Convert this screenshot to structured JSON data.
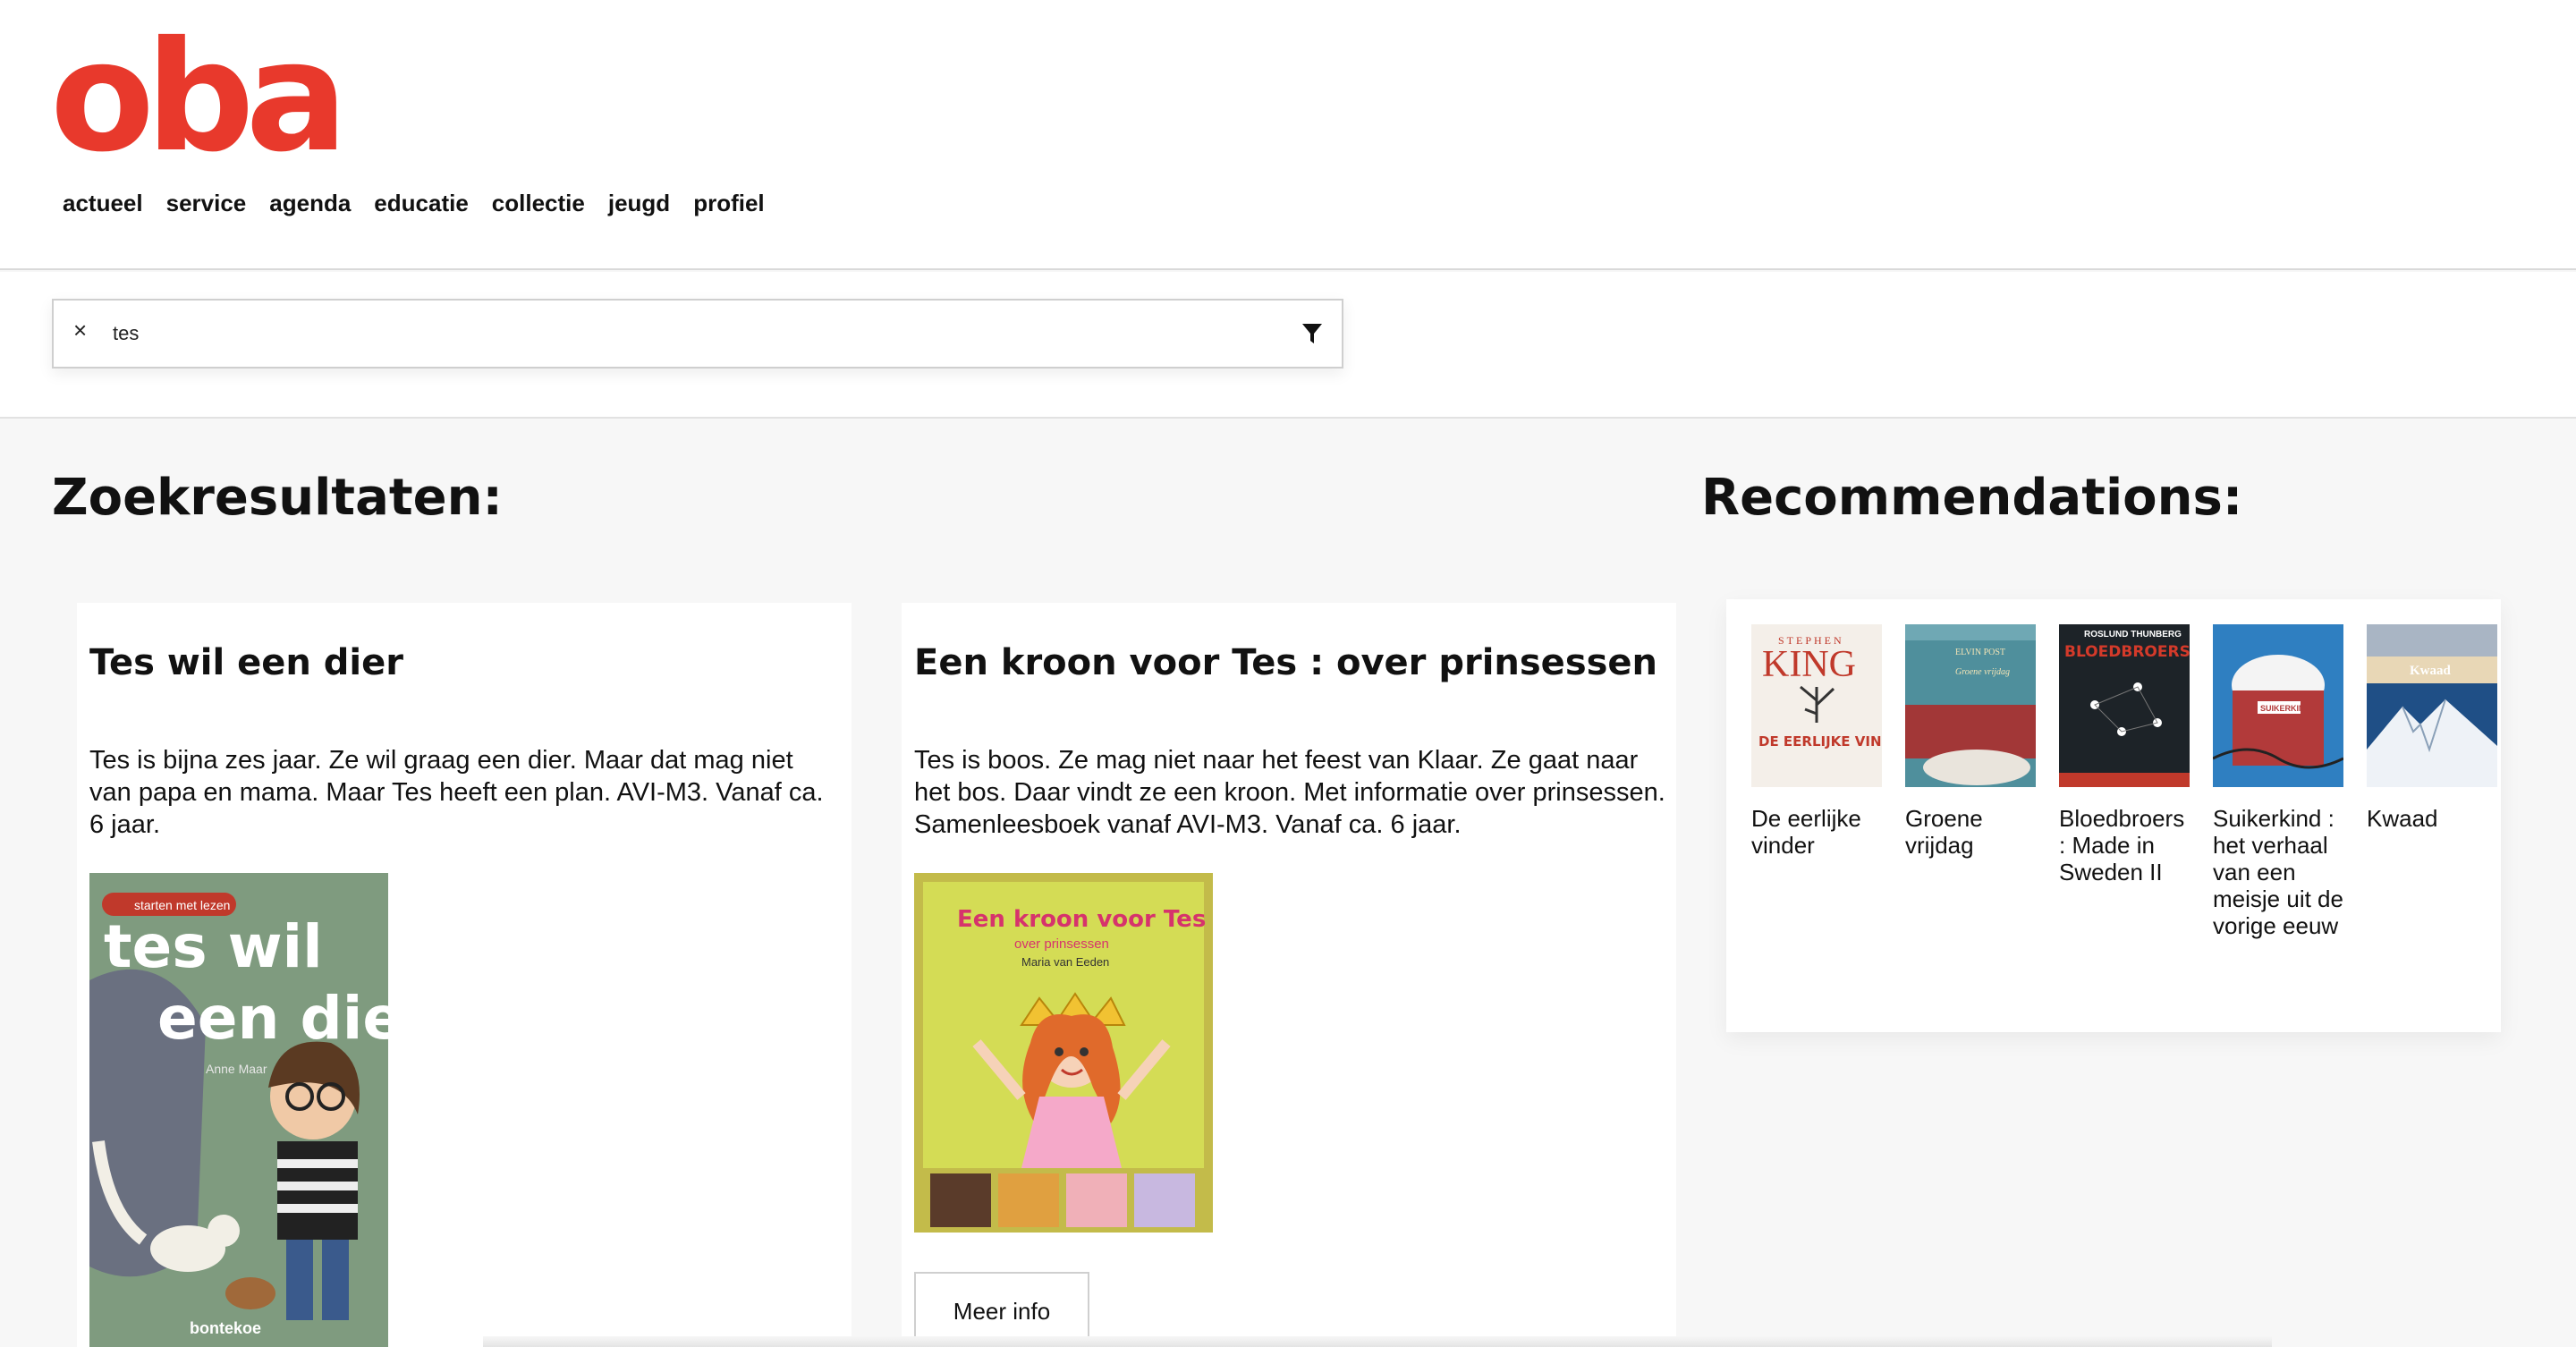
{
  "brand": {
    "logo_text": "oba",
    "color": "#e8392c"
  },
  "nav": {
    "items": [
      {
        "label": "actueel"
      },
      {
        "label": "service"
      },
      {
        "label": "agenda"
      },
      {
        "label": "educatie"
      },
      {
        "label": "collectie"
      },
      {
        "label": "jeugd"
      },
      {
        "label": "profiel"
      }
    ]
  },
  "search": {
    "clear_label": "×",
    "value": "tes"
  },
  "results": {
    "heading": "Zoekresultaten:",
    "items": [
      {
        "title": "Tes wil een dier",
        "description": "Tes is bijna zes jaar. Ze wil graag een dier. Maar dat mag niet van papa en mama. Maar Tes heeft een plan. AVI-M3. Vanaf ca. 6 jaar.",
        "cover": {
          "series": "starten met lezen",
          "line1": "tes wil",
          "line2": "een dier",
          "author": "Anne Maar",
          "publisher": "bontekoe"
        }
      },
      {
        "title": "Een kroon voor Tes : over prinsessen",
        "description": "Tes is boos. Ze mag niet naar het feest van Klaar. Ze gaat naar het bos. Daar vindt ze een kroon. Met informatie over prinsessen. Samenleesboek vanaf AVI-M3. Vanaf ca. 6 jaar.",
        "cover": {
          "title": "Een kroon voor Tes",
          "subtitle": "over prinsessen",
          "author": "Maria van Eeden"
        },
        "more_label": "Meer info"
      }
    ]
  },
  "recommendations": {
    "heading": "Recommendations:",
    "items": [
      {
        "title": "De eerlijke vinder",
        "cover": {
          "author": "STEPHEN",
          "author2": "KING",
          "title": "DE EERLIJKE VINDER"
        }
      },
      {
        "title": "Groene vrijdag",
        "cover": {
          "author": "ELVIN POST",
          "title": "Groene vrijdag"
        }
      },
      {
        "title": "Bloedbroers : Made in Sweden II",
        "cover": {
          "author": "ROSLUND THUNBERG",
          "title": "BLOEDBROERS"
        }
      },
      {
        "title": "Suikerkind : het verhaal van een meisje uit de vorige eeuw",
        "cover": {
          "title": "SUIKERKIND"
        }
      },
      {
        "title": "Kwaad",
        "cover": {
          "title": "Kwaad"
        }
      }
    ]
  }
}
